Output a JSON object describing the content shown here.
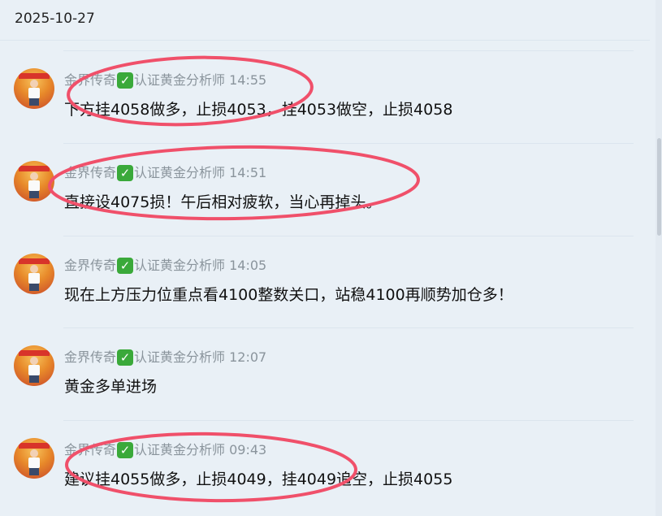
{
  "date_header": "2025-10-27",
  "author": "金界传奇",
  "badge_icon": "check-mark-button-icon",
  "badge_glyph": "✓",
  "author_title": "认证黄金分析师",
  "annotation_color": "#f0506a",
  "messages": [
    {
      "time": "14:55",
      "text": "下方挂4058做多，止损4053，挂4053做空，止损4058"
    },
    {
      "time": "14:51",
      "text": "直接设4075损！午后相对疲软，当心再掉头。"
    },
    {
      "time": "14:05",
      "text": "现在上方压力位重点看4100整数关口，站稳4100再顺势加仓多！"
    },
    {
      "time": "12:07",
      "text": "黄金多单进场"
    },
    {
      "time": "09:43",
      "text": "建议挂4055做多，止损4049，挂4049追空，止损4055"
    }
  ]
}
